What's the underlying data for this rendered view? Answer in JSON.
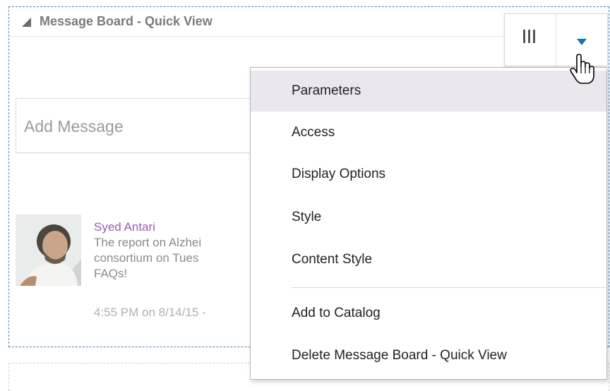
{
  "portlet": {
    "title": "Message Board - Quick View"
  },
  "toolbar": {
    "columns_icon": "columns-icon",
    "menu_icon": "caret-down-icon",
    "accent_color": "#1a6fb8"
  },
  "add_message": {
    "placeholder": "Add Message"
  },
  "message": {
    "author": "Syed Antari",
    "lines": [
      "The report on Alzhei",
      "consortium on Tues",
      "FAQs!"
    ],
    "time": "4:55 PM on 8/14/15 -",
    "author_color": "#9b59b6"
  },
  "menu": {
    "items": [
      {
        "label": "Parameters",
        "highlighted": true
      },
      {
        "label": "Access"
      },
      {
        "label": "Display Options"
      },
      {
        "label": "Style"
      },
      {
        "label": "Content Style"
      },
      {
        "label": "Add to Catalog"
      },
      {
        "label": "Delete Message Board - Quick View"
      }
    ],
    "highlight_color": "#ece6ee"
  }
}
